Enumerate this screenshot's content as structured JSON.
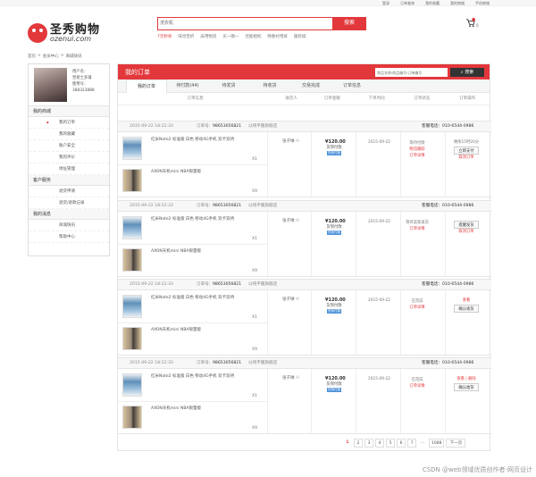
{
  "topnav": [
    "登录",
    "订单查询",
    "我的收藏",
    "我的商城",
    "手机商城"
  ],
  "logo": {
    "cn": "圣秀购物",
    "en": "ozenui.com"
  },
  "search": {
    "value": "洗衣机",
    "button": "搜索"
  },
  "hotwords": [
    "7元秒杀",
    "味觉百折",
    "床用物资",
    "买一赠一",
    "佳能相机",
    "畅春衬用屏",
    "服装城"
  ],
  "cart": {
    "count": "0"
  },
  "breadcrumb": [
    "首页",
    "会员中心",
    "商城快讯"
  ],
  "profile": {
    "name_label": "用户名：",
    "name": "昱君士多铺",
    "level_label": "使用号：",
    "phone": "388323888"
  },
  "sidebar": {
    "groups": [
      {
        "title": "我的商城",
        "items": [
          "我的订单",
          "我的收藏",
          "账户安全",
          "我的评价",
          "地址管理"
        ]
      },
      {
        "title": "客户服务",
        "items": [
          "退货申请",
          "退货/退款记录"
        ]
      },
      {
        "title": "我的消息",
        "items": [
          "商城快讯",
          "帮助中心"
        ]
      }
    ]
  },
  "main": {
    "title": "我的订单",
    "search_placeholder": "商品名称/商品编号/订单编号",
    "search_button": "搜索",
    "tabs": [
      "我的订单",
      "待付款(44)",
      "待发货",
      "待收货",
      "交易完成",
      "订单信息"
    ],
    "columns": [
      "订单信息",
      "收货人",
      "订单金额",
      "下单时间",
      "订单状态",
      "订单操作"
    ]
  },
  "orders": [
    {
      "date": "2015-09-22 18:22:33",
      "no_label": "订单号：",
      "no": "98653056821",
      "shop": "以纯平服旗舰店",
      "tel": "客服电话：010-6544-0986",
      "products": [
        {
          "name": "红米Note2 标准版 白色 移动4G手机 双卡双待",
          "qty": "X1"
        },
        {
          "name": "AXON天机mini NBA限量版",
          "qty": "X9"
        }
      ],
      "receiver": "张子琳",
      "amount": "¥120.00",
      "pay": "货到付款",
      "pay_badge": "货到付款",
      "time": "2015-09-22",
      "status": [
        "等待付款",
        "物流跟踪",
        "订单详情"
      ],
      "ops": [
        "剩余15时20分",
        "立即支付",
        "取消订单"
      ]
    },
    {
      "date": "2015-09-22 18:22:33",
      "no_label": "订单号：",
      "no": "98653056821",
      "shop": "以纯平服旗舰店",
      "tel": "客服电话：010-6544-0986",
      "products": [
        {
          "name": "红米Note2 标准版 白色 移动4G手机 双卡双待",
          "qty": "X1"
        },
        {
          "name": "AXON天机mini NBA限量版",
          "qty": "X9"
        }
      ],
      "receiver": "张子琳",
      "amount": "¥120.00",
      "pay": "货到付款",
      "pay_badge": "货到付款",
      "time": "2015-09-22",
      "status": [
        "等待卖家发货",
        "订单详情"
      ],
      "ops": [
        "提醒发货",
        "取消订单"
      ]
    },
    {
      "date": "2015-09-22 18:22:33",
      "no_label": "订单号：",
      "no": "98653056821",
      "shop": "以纯平服旗舰店",
      "tel": "客服电话：010-6544-0986",
      "products": [
        {
          "name": "红米Note2 标准版 白色 移动4G手机 双卡双待",
          "qty": "X1"
        },
        {
          "name": "AXON天机mini NBA限量版",
          "qty": "X9"
        }
      ],
      "receiver": "张子琳",
      "amount": "¥120.00",
      "pay": "货到付款",
      "pay_badge": "货到付款",
      "time": "2015-09-22",
      "status": [
        "已完成",
        "订单详情"
      ],
      "ops": [
        "查看",
        "确认收货"
      ]
    },
    {
      "date": "2015-09-22 18:22:33",
      "no_label": "订单号：",
      "no": "98653056821",
      "shop": "以纯平服旗舰店",
      "tel": "客服电话：010-6544-0986",
      "products": [
        {
          "name": "红米Note2 标准版 白色 移动4G手机 双卡双待",
          "qty": "X1"
        },
        {
          "name": "AXON天机mini NBA限量版",
          "qty": "X9"
        }
      ],
      "receiver": "张子琳",
      "amount": "¥120.00",
      "pay": "货到付款",
      "pay_badge": "货到付款",
      "time": "2015-09-22",
      "status": [
        "已完成",
        "订单详情"
      ],
      "ops": [
        "查看 | 删除",
        "确认收货"
      ]
    }
  ],
  "pager": [
    "1",
    "2",
    "3",
    "4",
    "5",
    "6",
    "7",
    "…",
    "1088",
    "下一页"
  ],
  "watermark": "CSDN @web领域优质创作者-网页设计",
  "colors": {
    "accent": "#e2383c",
    "badge": "#4a90d9"
  }
}
